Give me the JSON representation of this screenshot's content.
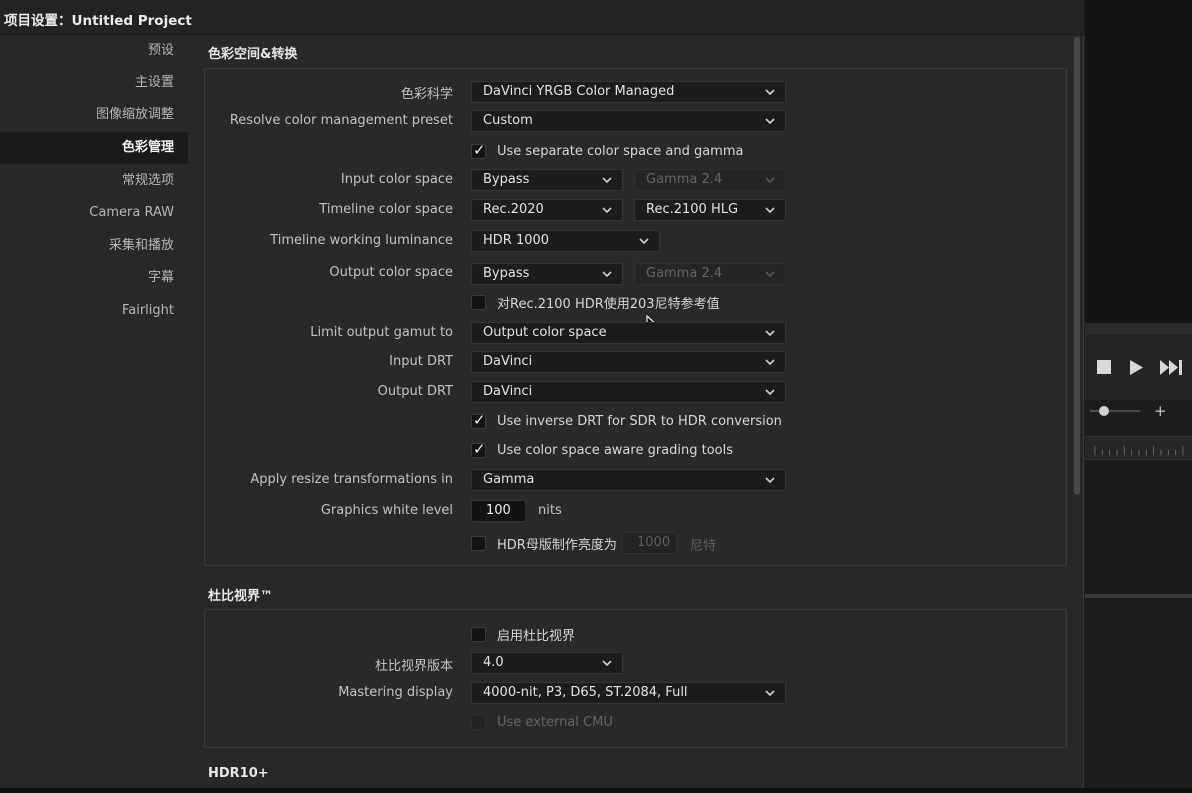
{
  "window": {
    "title": "项目设置：Untitled Project"
  },
  "sidebar": {
    "items": [
      {
        "label": "预设"
      },
      {
        "label": "主设置"
      },
      {
        "label": "图像缩放调整"
      },
      {
        "label": "色彩管理",
        "active": true
      },
      {
        "label": "常规选项"
      },
      {
        "label": "Camera RAW"
      },
      {
        "label": "采集和播放"
      },
      {
        "label": "字幕"
      },
      {
        "label": "Fairlight"
      }
    ]
  },
  "color_section": {
    "title": "色彩空间&转换",
    "color_science": {
      "label": "色彩科学",
      "value": "DaVinci YRGB Color Managed"
    },
    "cm_preset": {
      "label": "Resolve color management preset",
      "value": "Custom"
    },
    "separate_gamma": {
      "label": "Use separate color space and gamma",
      "checked": true
    },
    "input_space": {
      "label": "Input color space",
      "value": "Bypass",
      "gamma": "Gamma 2.4"
    },
    "timeline_space": {
      "label": "Timeline color space",
      "value": "Rec.2020",
      "gamma": "Rec.2100 HLG"
    },
    "working_luminance": {
      "label": "Timeline working luminance",
      "value": "HDR 1000"
    },
    "output_space": {
      "label": "Output color space",
      "value": "Bypass",
      "gamma": "Gamma 2.4"
    },
    "rec2100_ref": {
      "label": "对Rec.2100 HDR使用203尼特参考值",
      "checked": false
    },
    "limit_gamut": {
      "label": "Limit output gamut to",
      "value": "Output color space"
    },
    "input_drt": {
      "label": "Input DRT",
      "value": "DaVinci"
    },
    "output_drt": {
      "label": "Output DRT",
      "value": "DaVinci"
    },
    "inverse_drt": {
      "label": "Use inverse DRT for SDR to HDR conversion",
      "checked": true
    },
    "aware_tools": {
      "label": "Use color space aware grading tools",
      "checked": true
    },
    "resize_in": {
      "label": "Apply resize transformations in",
      "value": "Gamma"
    },
    "white_level": {
      "label": "Graphics white level",
      "value": "100",
      "unit": "nits"
    },
    "hdr_mastering": {
      "label": "HDR母版制作亮度为",
      "value": "1000",
      "unit": "尼特",
      "checked": false
    }
  },
  "dolby_section": {
    "title": "杜比视界™",
    "enable": {
      "label": "启用杜比视界",
      "checked": false
    },
    "version": {
      "label": "杜比视界版本",
      "value": "4.0"
    },
    "mastering_display": {
      "label": "Mastering display",
      "value": "4000-nit, P3, D65, ST.2084, Full"
    },
    "external_cmu": {
      "label": "Use external CMU",
      "checked": false
    }
  },
  "hdr10_section": {
    "title": "HDR10+"
  },
  "transport": {
    "stop_icon": "stop-icon",
    "play_icon": "play-icon",
    "skip_icon": "skip-to-end-icon",
    "zoom_plus": "+"
  },
  "colors": {
    "panel_bg": "#29292c",
    "dialog_bg": "#28282b",
    "active_nav_bg": "#1b1b1d",
    "field_bg": "#1c1c1e"
  }
}
